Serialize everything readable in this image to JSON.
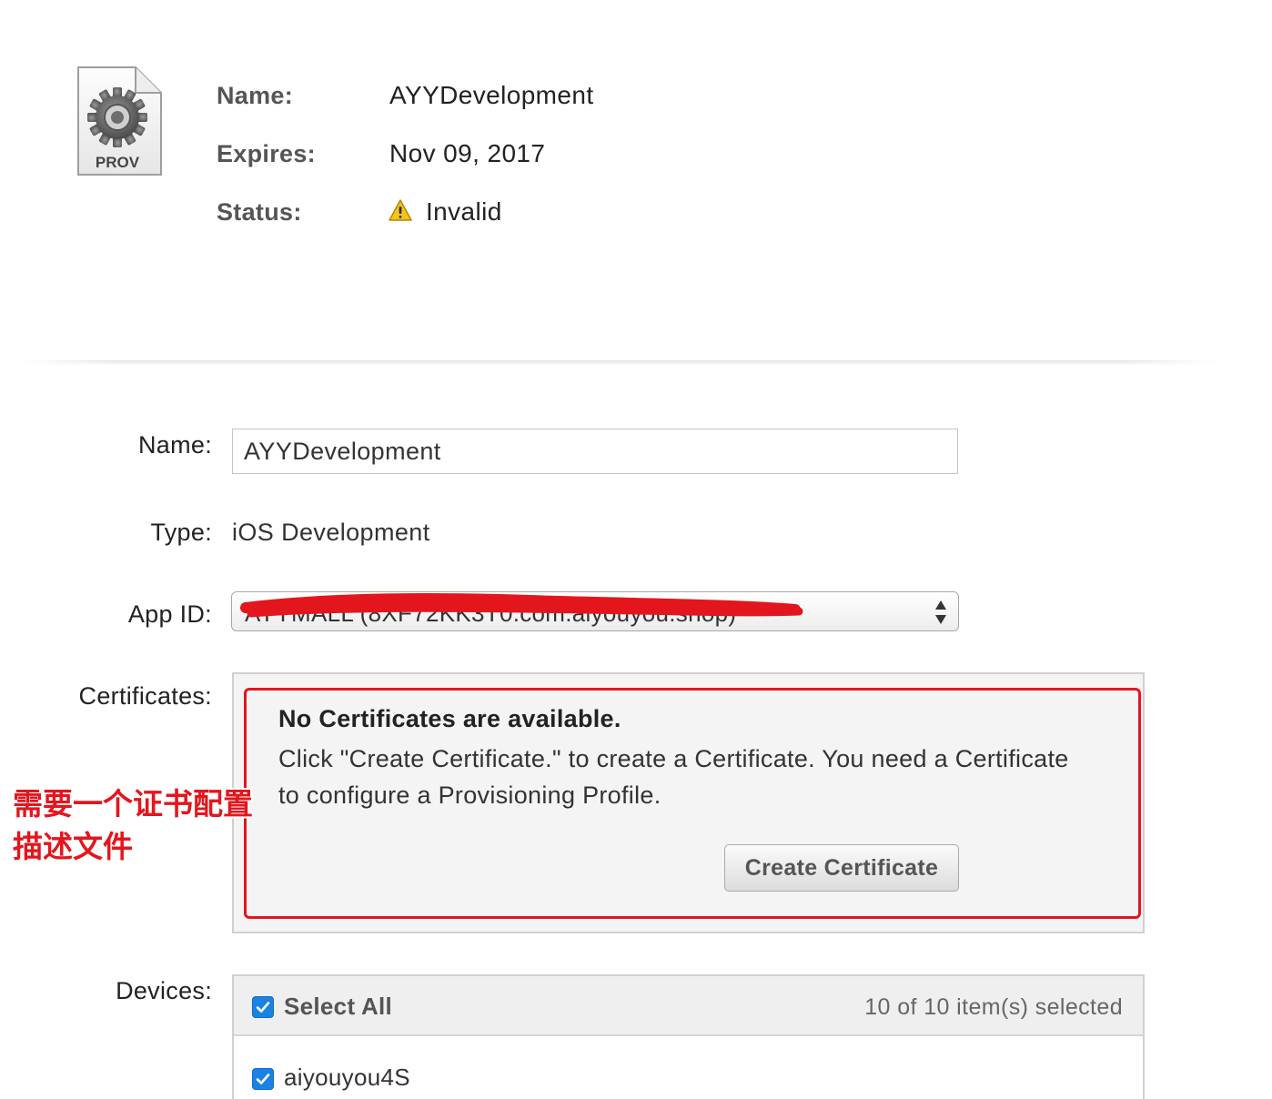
{
  "profile": {
    "icon_text": "PROV",
    "name_label": "Name:",
    "name_value": "AYYDevelopment",
    "expires_label": "Expires:",
    "expires_value": "Nov 09, 2017",
    "status_label": "Status:",
    "status_value": "Invalid",
    "status_icon": "warning-icon"
  },
  "form": {
    "name_label": "Name:",
    "name_value": "AYYDevelopment",
    "type_label": "Type:",
    "type_value": "iOS Development",
    "app_id_label": "App ID:",
    "app_id_value": "AYYMALL (8XF72KK3T0.com.aiyouyou.shop)",
    "certificates_label": "Certificates:",
    "devices_label": "Devices:"
  },
  "certificates": {
    "title": "No Certificates are available.",
    "message_line1": "Click \"Create Certificate.\" to create a Certificate. You need a Certificate",
    "message_line2": "to configure a Provisioning Profile.",
    "create_button": "Create Certificate"
  },
  "annotation": {
    "line1": "需要一个证书配置",
    "line2": "描述文件",
    "color": "#e3161d"
  },
  "devices": {
    "select_all_label": "Select All",
    "select_all_checked": true,
    "selected_count": "10 of 10 item(s) selected",
    "items": [
      {
        "label": "aiyouyou4S",
        "checked": true
      }
    ]
  },
  "colors": {
    "accent_checkbox": "#1a82e2",
    "highlight_red": "#e3161d",
    "warning_yellow": "#f5c518"
  }
}
